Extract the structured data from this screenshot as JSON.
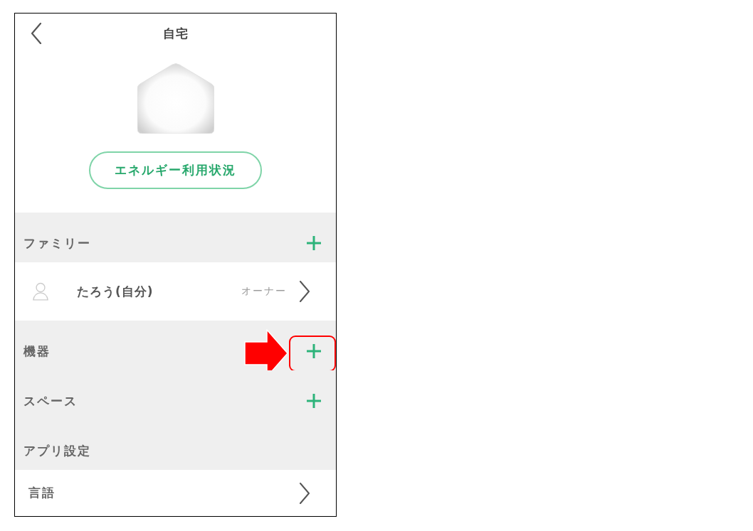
{
  "header": {
    "title": "自宅"
  },
  "energy_button": {
    "label": "エネルギー利用状況"
  },
  "sections": [
    {
      "title": "ファミリー",
      "addable": true,
      "highlighted": false,
      "rows": [
        {
          "kind": "member",
          "name": "たろう(自分)",
          "role": "オーナー"
        }
      ]
    },
    {
      "title": "機器",
      "addable": true,
      "highlighted": true
    },
    {
      "title": "スペース",
      "addable": true,
      "highlighted": false
    },
    {
      "title": "アプリ設定",
      "addable": false,
      "highlighted": false,
      "rows": [
        {
          "kind": "setting",
          "label": "言語"
        }
      ]
    }
  ]
}
